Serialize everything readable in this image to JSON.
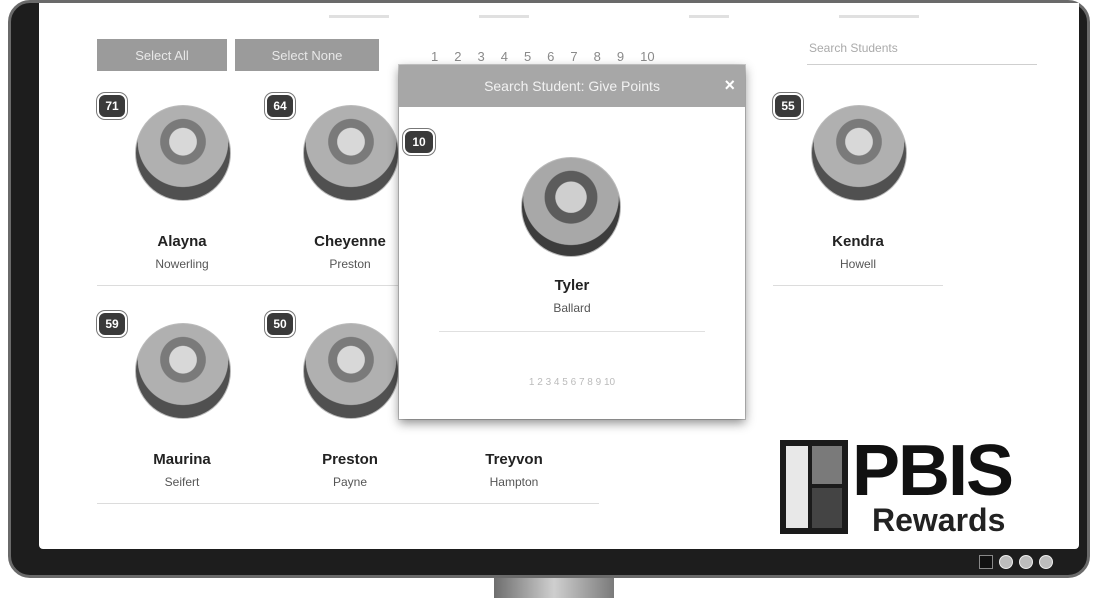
{
  "toolbar": {
    "select_all_label": "Select All",
    "select_none_label": "Select None",
    "pages": [
      "1",
      "2",
      "3",
      "4",
      "5",
      "6",
      "7",
      "8",
      "9",
      "10"
    ],
    "search_placeholder": "Search Students"
  },
  "students": [
    {
      "points": "71",
      "first": "Alayna",
      "last": "Nowerling"
    },
    {
      "points": "64",
      "first": "Cheyenne",
      "last": "Preston"
    },
    {
      "points": "55",
      "first": "Kendra",
      "last": "Howell"
    },
    {
      "points": "59",
      "first": "Maurina",
      "last": "Seifert"
    },
    {
      "points": "50",
      "first": "Preston",
      "last": "Payne"
    },
    {
      "points": "",
      "first": "Treyvon",
      "last": "Hampton"
    }
  ],
  "modal": {
    "title": "Search Student: Give Points",
    "close_label": "×",
    "student": {
      "points": "10",
      "first": "Tyler",
      "last": "Ballard"
    },
    "footer_text": "1 2 3 4 5 6 7 8 9 10"
  },
  "logo": {
    "pbis": "PBIS",
    "rewards": "Rewards"
  }
}
